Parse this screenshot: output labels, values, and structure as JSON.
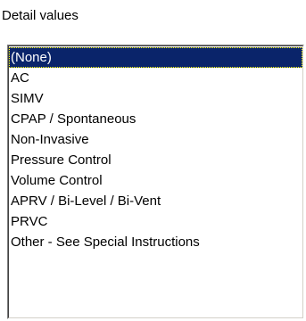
{
  "panel": {
    "label": "Detail values"
  },
  "list": {
    "items": [
      {
        "label": "(None)",
        "selected": true
      },
      {
        "label": "AC",
        "selected": false
      },
      {
        "label": "SIMV",
        "selected": false
      },
      {
        "label": "CPAP / Spontaneous",
        "selected": false
      },
      {
        "label": "Non-Invasive",
        "selected": false
      },
      {
        "label": "Pressure Control",
        "selected": false
      },
      {
        "label": "Volume Control",
        "selected": false
      },
      {
        "label": "APRV / Bi-Level / Bi-Vent",
        "selected": false
      },
      {
        "label": "PRVC",
        "selected": false
      },
      {
        "label": "Other - See Special Instructions",
        "selected": false
      }
    ],
    "selection_color": "#0a246a"
  }
}
